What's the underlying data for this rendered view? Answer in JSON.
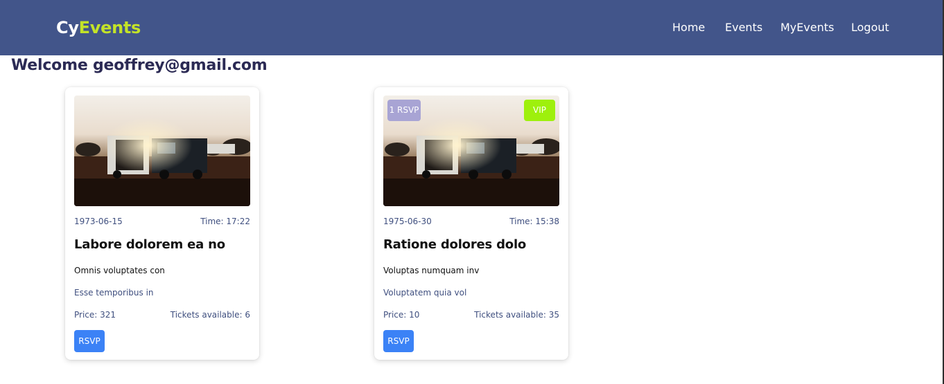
{
  "app": {
    "brand_prefix": "Cy",
    "brand_suffix": "Events"
  },
  "nav": {
    "items": [
      {
        "label": "Home"
      },
      {
        "label": "Events"
      },
      {
        "label": "MyEvents"
      },
      {
        "label": "Logout"
      }
    ]
  },
  "welcome": "Welcome geoffrey@gmail.com",
  "colors": {
    "navbar": "#42558a",
    "brand_accent": "#c3e328",
    "rsvp_button": "#3b82f6",
    "rsvp_badge": "#a8a4d4",
    "vip_badge": "#9ef00c"
  },
  "events": [
    {
      "image_icon": "campervan-photo",
      "date": "1973-06-15",
      "time": "Time: 17:22",
      "title": "Labore dolorem ea no",
      "description": "Omnis voluptates con",
      "subtitle": "Esse temporibus in",
      "price": "Price: 321",
      "tickets": "Tickets available: 6",
      "button": "RSVP"
    },
    {
      "image_icon": "campervan-photo",
      "rsvp_count": "1 RSVP",
      "vip": "VIP",
      "date": "1975-06-30",
      "time": "Time: 15:38",
      "title": "Ratione dolores dolo",
      "description": "Voluptas numquam inv",
      "subtitle": "Voluptatem quia vol",
      "price": "Price: 10",
      "tickets": "Tickets available: 35",
      "button": "RSVP"
    }
  ]
}
